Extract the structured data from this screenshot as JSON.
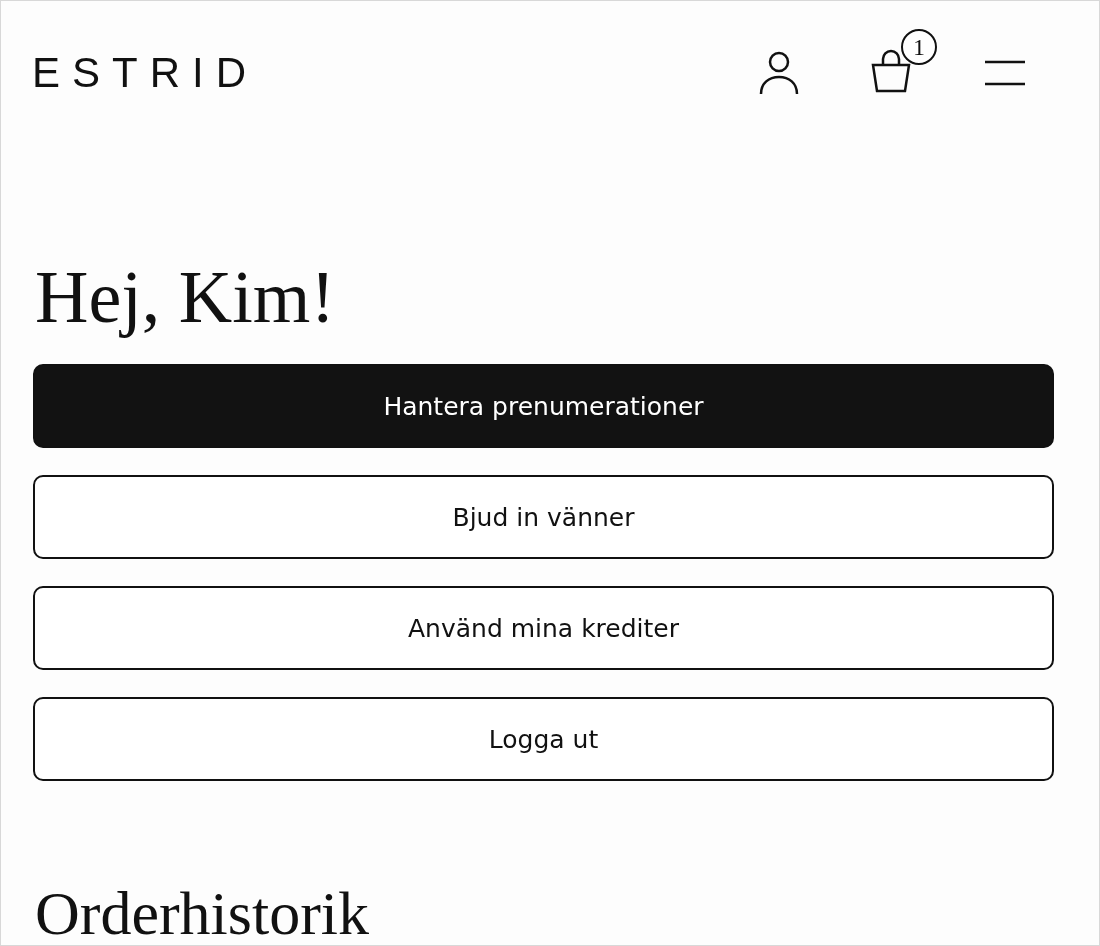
{
  "header": {
    "logo": "ESTRID",
    "cart_count": "1"
  },
  "greeting": "Hej, Kim!",
  "buttons": [
    {
      "label": "Hantera prenumerationer",
      "kind": "primary"
    },
    {
      "label": "Bjud in vänner",
      "kind": "outline"
    },
    {
      "label": "Använd mina krediter",
      "kind": "outline"
    },
    {
      "label": "Logga ut",
      "kind": "outline"
    }
  ],
  "section_title": "Orderhistorik"
}
